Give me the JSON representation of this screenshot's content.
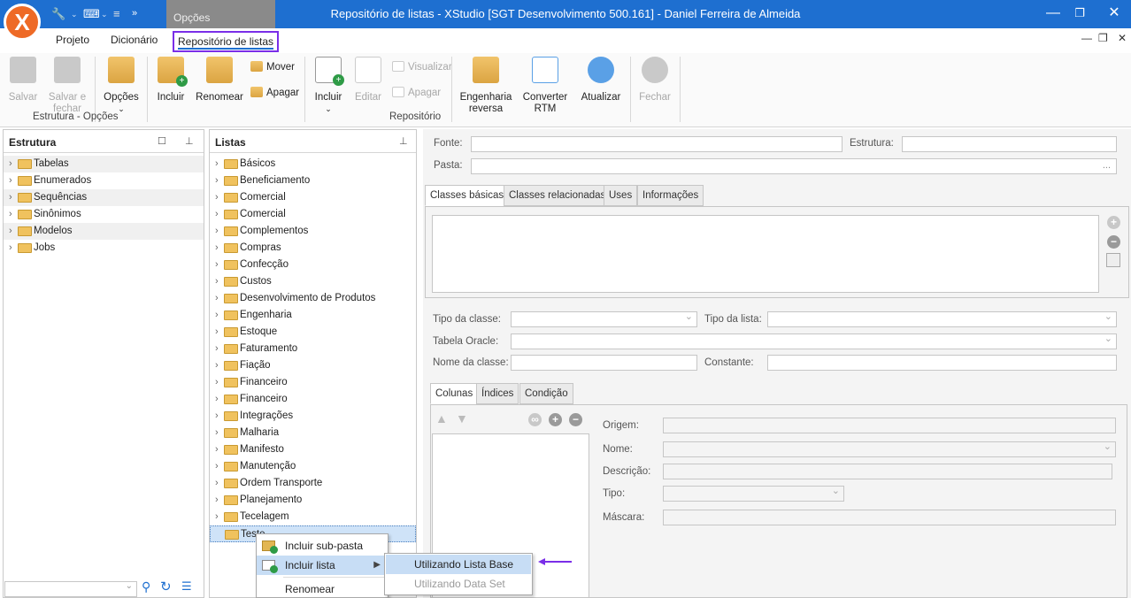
{
  "window": {
    "title": "Repositório de listas - XStudio [SGT Desenvolvimento 500.161] - Daniel Ferreira de Almeida",
    "context_tab": "Opções",
    "logo": "X"
  },
  "menu": {
    "tabs": [
      "Projeto",
      "Dicionário",
      "Repositório de listas"
    ]
  },
  "ribbon": {
    "salvar": "Salvar",
    "salvar_fechar_1": "Salvar e",
    "salvar_fechar_2": "fechar",
    "opcoes": "Opções",
    "group1": "Estrutura - Opções",
    "incluir": "Incluir",
    "renomear": "Renomear",
    "mover": "Mover",
    "apagar": "Apagar",
    "incluir2": "Incluir",
    "editar": "Editar",
    "visualizar": "Visualizar",
    "apagar2": "Apagar",
    "engenharia_1": "Engenharia",
    "engenharia_2": "reversa",
    "converter_1": "Converter",
    "converter_2": "RTM",
    "atualizar": "Atualizar",
    "fechar": "Fechar",
    "group2": "Repositório"
  },
  "estrutura": {
    "title": "Estrutura",
    "items": [
      "Tabelas",
      "Enumerados",
      "Sequências",
      "Sinônimos",
      "Modelos",
      "Jobs"
    ]
  },
  "listas": {
    "title": "Listas",
    "items": [
      "Básicos",
      "Beneficiamento",
      "Comercial",
      "Comercial",
      "Complementos",
      "Compras",
      "Confecção",
      "Custos",
      "Desenvolvimento de Produtos",
      "Engenharia",
      "Estoque",
      "Faturamento",
      "Fiação",
      "Financeiro",
      "Financeiro",
      "Integrações",
      "Malharia",
      "Manifesto",
      "Manutenção",
      "Ordem Transporte",
      "Planejamento",
      "Tecelagem",
      "Teste"
    ]
  },
  "form": {
    "fonte": "Fonte:",
    "estrutura": "Estrutura:",
    "pasta": "Pasta:",
    "tabs1": [
      "Classes básicas",
      "Classes relacionadas",
      "Uses",
      "Informações"
    ],
    "tipo_classe": "Tipo da classe:",
    "tipo_lista": "Tipo da lista:",
    "tabela_oracle": "Tabela Oracle:",
    "nome_classe": "Nome da classe:",
    "constante": "Constante:",
    "tabs2": [
      "Colunas",
      "Índices",
      "Condição"
    ],
    "origem": "Origem:",
    "nome": "Nome:",
    "descricao": "Descrição:",
    "tipo": "Tipo:",
    "mascara": "Máscara:"
  },
  "context_menu": {
    "items": [
      "Incluir sub-pasta",
      "Incluir lista",
      "Renomear"
    ],
    "submenu": [
      "Utilizando Lista Base",
      "Utilizando Data Set"
    ]
  },
  "colors": {
    "titlebar": "#1e6fd0",
    "highlight": "#7a2ee8",
    "accent_orange": "#ee6a26"
  }
}
